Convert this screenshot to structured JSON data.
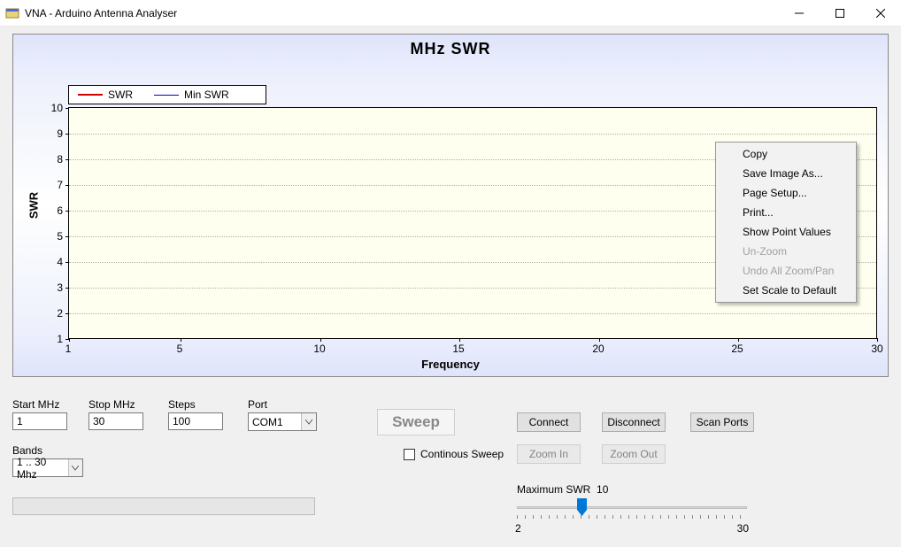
{
  "window": {
    "title": "VNA - Arduino Antenna Analyser"
  },
  "chart_data": {
    "type": "line",
    "title": "MHz   SWR",
    "xlabel": "Frequency",
    "ylabel": "SWR",
    "xlim": [
      1,
      30
    ],
    "ylim": [
      1,
      10
    ],
    "x_ticks": [
      1,
      5,
      10,
      15,
      20,
      25,
      30
    ],
    "y_ticks": [
      1,
      2,
      3,
      4,
      5,
      6,
      7,
      8,
      9,
      10
    ],
    "series": [
      {
        "name": "SWR",
        "color": "#d00000",
        "values": []
      },
      {
        "name": "Min SWR",
        "color": "#0000cc",
        "values": []
      }
    ]
  },
  "context_menu": {
    "items": [
      {
        "label": "Copy",
        "enabled": true
      },
      {
        "label": "Save Image As...",
        "enabled": true
      },
      {
        "label": "Page Setup...",
        "enabled": true
      },
      {
        "label": "Print...",
        "enabled": true
      },
      {
        "label": "Show Point Values",
        "enabled": true
      },
      {
        "label": "Un-Zoom",
        "enabled": false
      },
      {
        "label": "Undo All Zoom/Pan",
        "enabled": false
      },
      {
        "label": "Set Scale to Default",
        "enabled": true
      }
    ]
  },
  "inputs": {
    "start_mhz": {
      "label": "Start MHz",
      "value": "1"
    },
    "stop_mhz": {
      "label": "Stop MHz",
      "value": "30"
    },
    "steps": {
      "label": "Steps",
      "value": "100"
    },
    "port": {
      "label": "Port",
      "value": "COM1"
    },
    "bands": {
      "label": "Bands",
      "value": "1 .. 30 Mhz"
    }
  },
  "buttons": {
    "sweep": "Sweep",
    "connect": "Connect",
    "disconnect": "Disconnect",
    "scan_ports": "Scan Ports",
    "zoom_in": "Zoom In",
    "zoom_out": "Zoom Out"
  },
  "continuous_sweep": {
    "label": "Continous Sweep",
    "checked": false
  },
  "max_swr": {
    "label": "Maximum SWR",
    "value": "10",
    "min_label": "2",
    "max_label": "30"
  }
}
